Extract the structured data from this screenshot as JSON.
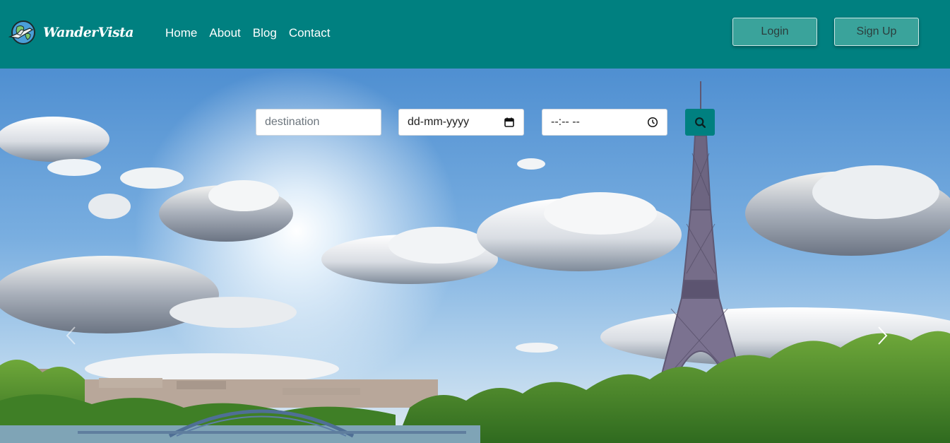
{
  "header": {
    "brand": "WanderVista",
    "nav": [
      {
        "label": "Home"
      },
      {
        "label": "About"
      },
      {
        "label": "Blog"
      },
      {
        "label": "Contact"
      }
    ],
    "login_label": "Login",
    "signup_label": "Sign Up",
    "colors": {
      "bar": "#008080",
      "button": "#3aa39b"
    }
  },
  "search": {
    "destination_placeholder": "destination",
    "date_display": "dd-mm-yyyy",
    "time_display": "--:-- --",
    "date_icon": "calendar-icon",
    "time_icon": "clock-icon",
    "button_icon": "search-icon"
  },
  "hero": {
    "image": "Eiffel Tower and Paris skyline under blue sky with clouds",
    "prev_icon": "chevron-left-icon",
    "next_icon": "chevron-right-icon"
  }
}
